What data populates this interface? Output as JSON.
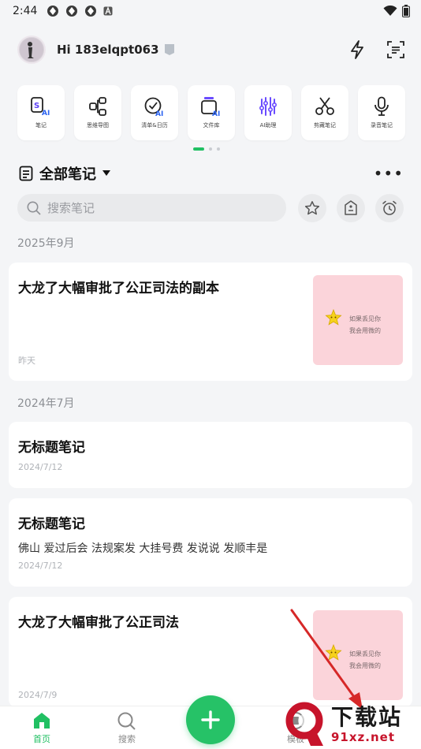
{
  "status": {
    "time": "2:44"
  },
  "header": {
    "greeting": "Hi 183elqpt063"
  },
  "tools": [
    {
      "label": "笔记",
      "icon": "note-ai-icon"
    },
    {
      "label": "思维导图",
      "icon": "mindmap-icon"
    },
    {
      "label": "清单&日历",
      "icon": "checklist-ai-icon"
    },
    {
      "label": "文件库",
      "icon": "file-library-ai-icon"
    },
    {
      "label": "AI助理",
      "icon": "ai-assistant-icon"
    },
    {
      "label": "剪藏笔记",
      "icon": "scissors-icon"
    },
    {
      "label": "录音笔记",
      "icon": "microphone-icon"
    }
  ],
  "section": {
    "title": "全部笔记"
  },
  "search": {
    "placeholder": "搜索笔记"
  },
  "groups": [
    {
      "label": "2025年9月"
    },
    {
      "label": "2024年7月"
    }
  ],
  "notes": [
    {
      "title": "大龙了大幅审批了公正司法的副本",
      "body": "",
      "date": "昨天",
      "thumb_text_1": "如果丢见你",
      "thumb_text_2": "我会用微的"
    },
    {
      "title": "无标题笔记",
      "body": "",
      "date": "2024/7/12"
    },
    {
      "title": "无标题笔记",
      "body": "佛山 爱过后会 法规案发 大挂号费 发说说 发顺丰是",
      "date": "2024/7/12"
    },
    {
      "title": "大龙了大幅审批了公正司法",
      "body": "",
      "date": "2024/7/9",
      "thumb_text_1": "如果丢见你",
      "thumb_text_2": "我会用微的"
    }
  ],
  "bottom_nav": {
    "home": "首页",
    "search": "搜索",
    "templates": "模板"
  },
  "watermark": {
    "big": "下载站",
    "small": "91xz.net"
  },
  "colors": {
    "accent": "#26c267",
    "thumb_bg": "#fbd4da",
    "arrow": "#d62828"
  }
}
